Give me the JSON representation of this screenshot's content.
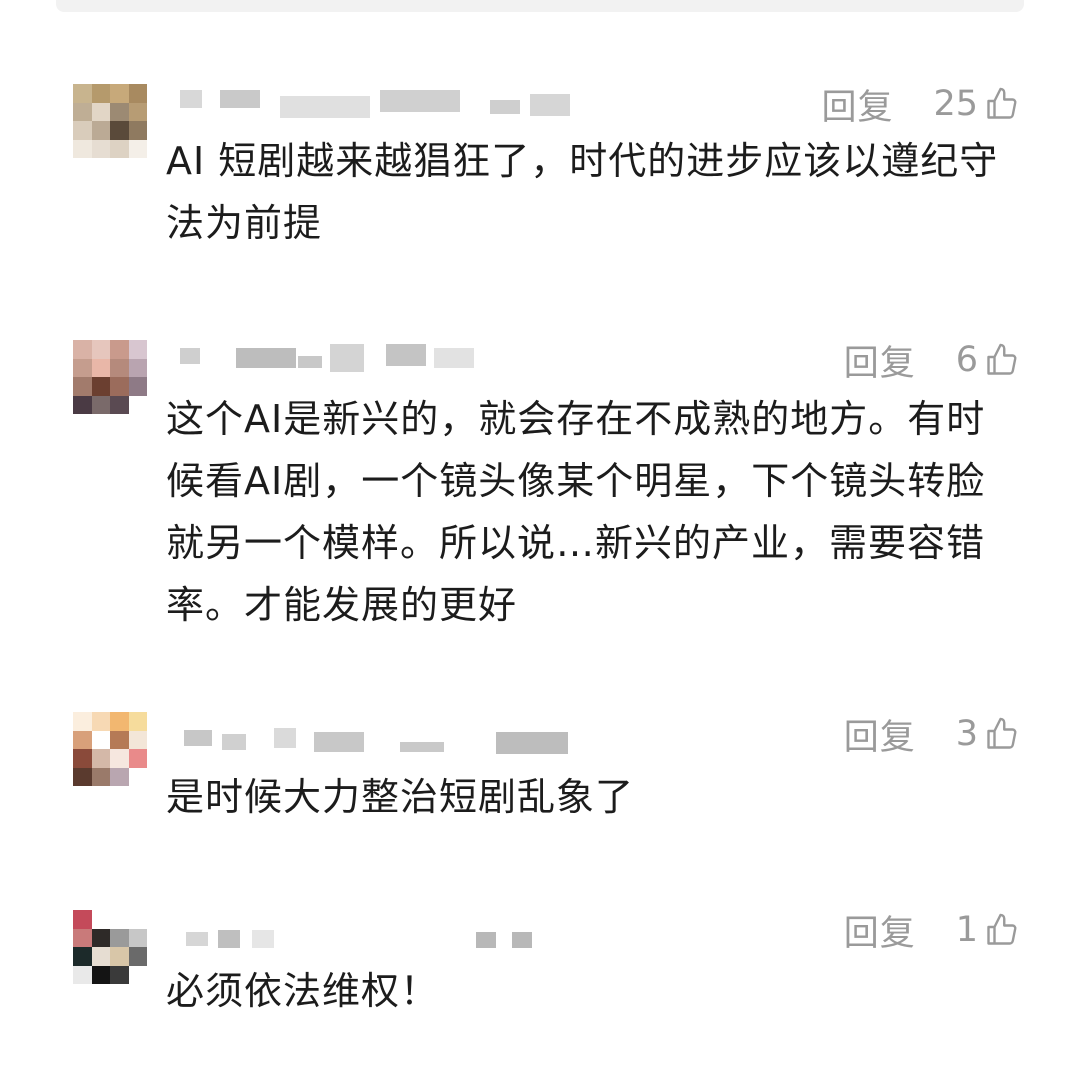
{
  "comments": [
    {
      "reply_label": "回复",
      "likes": "25",
      "text": "AI 短剧越来越猖狂了，时代的进步应该以遵纪守法为前提"
    },
    {
      "reply_label": "回复",
      "likes": "6",
      "text": "这个AI是新兴的，就会存在不成熟的地方。有时候看AI剧，一个镜头像某个明星，下个镜头转脸就另一个模样。所以说…新兴的产业，需要容错率。才能发展的更好"
    },
    {
      "reply_label": "回复",
      "likes": "3",
      "text": "是时候大力整治短剧乱象了"
    },
    {
      "reply_label": "回复",
      "likes": "1",
      "text": "必须依法维权！"
    }
  ],
  "icons": {
    "like": "thumbs-up-icon"
  },
  "colors": {
    "meta_text": "#9a9a9a",
    "body_text": "#1c1c1c"
  }
}
